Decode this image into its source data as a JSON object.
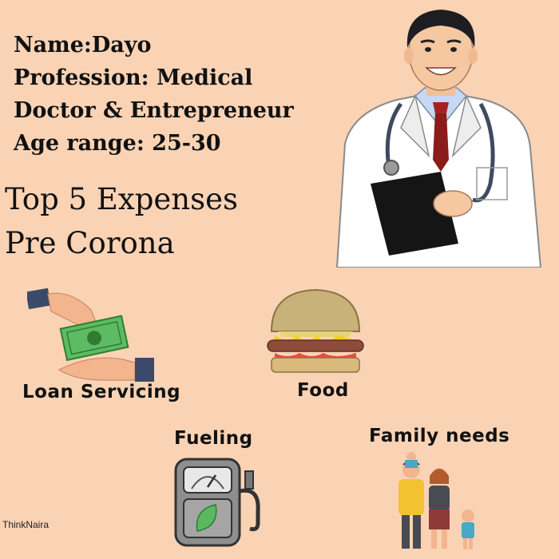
{
  "profile": {
    "name_line": "Name:Dayo",
    "profession_line_1": "Profession: Medical",
    "profession_line_2": "Doctor & Entrepreneur",
    "age_line": "Age range: 25-30"
  },
  "heading": {
    "line1": "Top 5 Expenses",
    "line2": "Pre Corona"
  },
  "expenses": [
    {
      "label": "Loan Servicing",
      "icon": "money-handover-icon"
    },
    {
      "label": "Food",
      "icon": "burger-icon"
    },
    {
      "label": "Fueling",
      "icon": "fuel-pump-icon"
    },
    {
      "label": "Family needs",
      "icon": "family-icon"
    }
  ],
  "credit": "ThinkNaira",
  "colors": {
    "background": "#FAD3B5",
    "text": "#111111"
  }
}
